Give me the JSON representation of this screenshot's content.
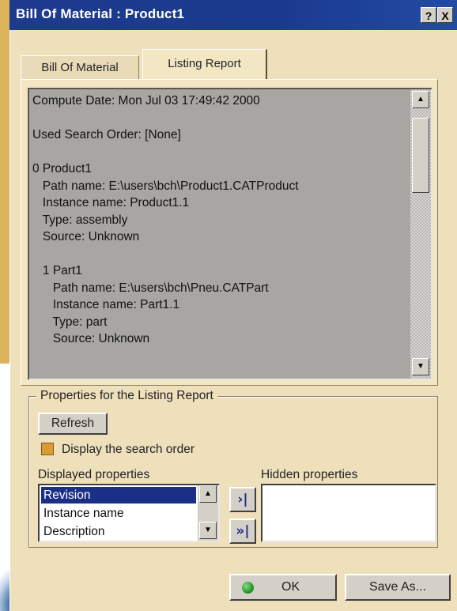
{
  "window": {
    "title": "Bill Of Material : Product1",
    "help_label": "?",
    "close_label": "X"
  },
  "tabs": [
    {
      "label": "Bill Of Material",
      "active": false
    },
    {
      "label": "Listing Report",
      "active": true
    }
  ],
  "report": {
    "lines": [
      "Compute Date: Mon Jul 03 17:49:42 2000",
      "",
      "Used Search Order: [None]",
      "",
      "0 Product1",
      "   Path name: E:\\users\\bch\\Product1.CATProduct",
      "   Instance name: Product1.1",
      "   Type: assembly",
      "   Source: Unknown",
      "",
      "   1 Part1",
      "      Path name: E:\\users\\bch\\Pneu.CATPart",
      "      Instance name: Part1.1",
      "      Type: part",
      "      Source: Unknown"
    ]
  },
  "properties": {
    "group_title": "Properties for the Listing Report",
    "refresh_label": "Refresh",
    "display_search_order_label": "Display the search order",
    "displayed_label": "Displayed properties",
    "hidden_label": "Hidden properties",
    "displayed_items": [
      {
        "label": "Revision",
        "selected": true
      },
      {
        "label": "Instance name",
        "selected": false
      },
      {
        "label": "Description",
        "selected": false
      }
    ],
    "move_one_label": "›|",
    "move_all_label": "»|"
  },
  "footer": {
    "ok_label": "OK",
    "save_as_label": "Save As..."
  },
  "colors": {
    "titlebar": "#1e3a8c",
    "dialog_bg": "#efe0bc",
    "selection": "#1c2f86"
  }
}
